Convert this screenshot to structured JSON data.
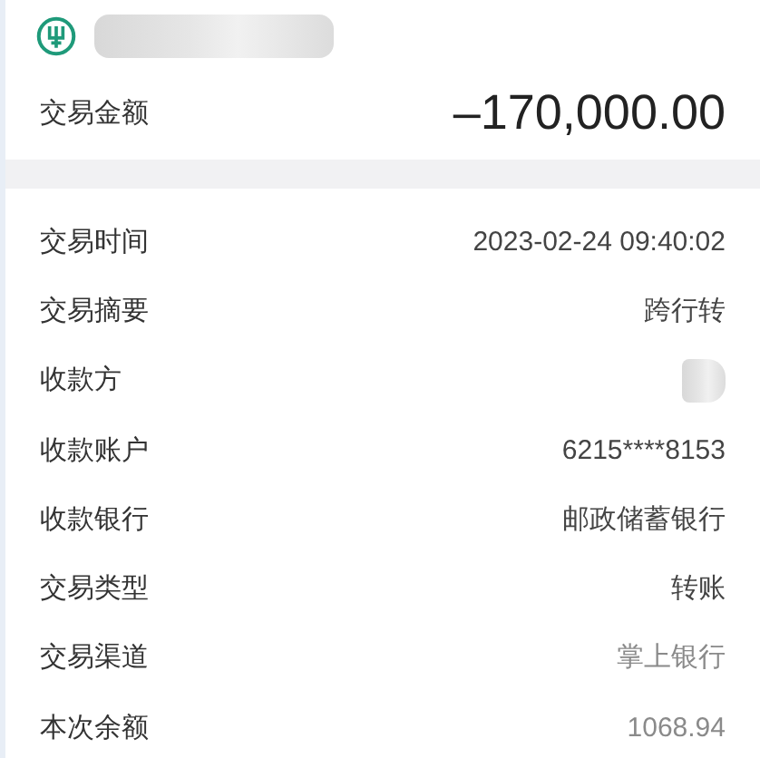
{
  "header": {
    "account_name": {
      "kind": "redacted"
    }
  },
  "amount": {
    "label": "交易金额",
    "value": "–170,000.00"
  },
  "details": [
    {
      "label": "交易时间",
      "kind": "text",
      "value": "2023-02-24 09:40:02"
    },
    {
      "label": "交易摘要",
      "kind": "text",
      "value": "跨行转"
    },
    {
      "label": "收款方",
      "kind": "redacted"
    },
    {
      "label": "收款账户",
      "kind": "text",
      "value": "6215****8153"
    },
    {
      "label": "收款银行",
      "kind": "text",
      "value": "邮政储蓄银行"
    },
    {
      "label": "交易类型",
      "kind": "text",
      "value": "转账"
    },
    {
      "label": "交易渠道",
      "kind": "text",
      "value": "掌上银行"
    },
    {
      "label": "本次余额",
      "kind": "text",
      "value": "1068.94"
    }
  ]
}
